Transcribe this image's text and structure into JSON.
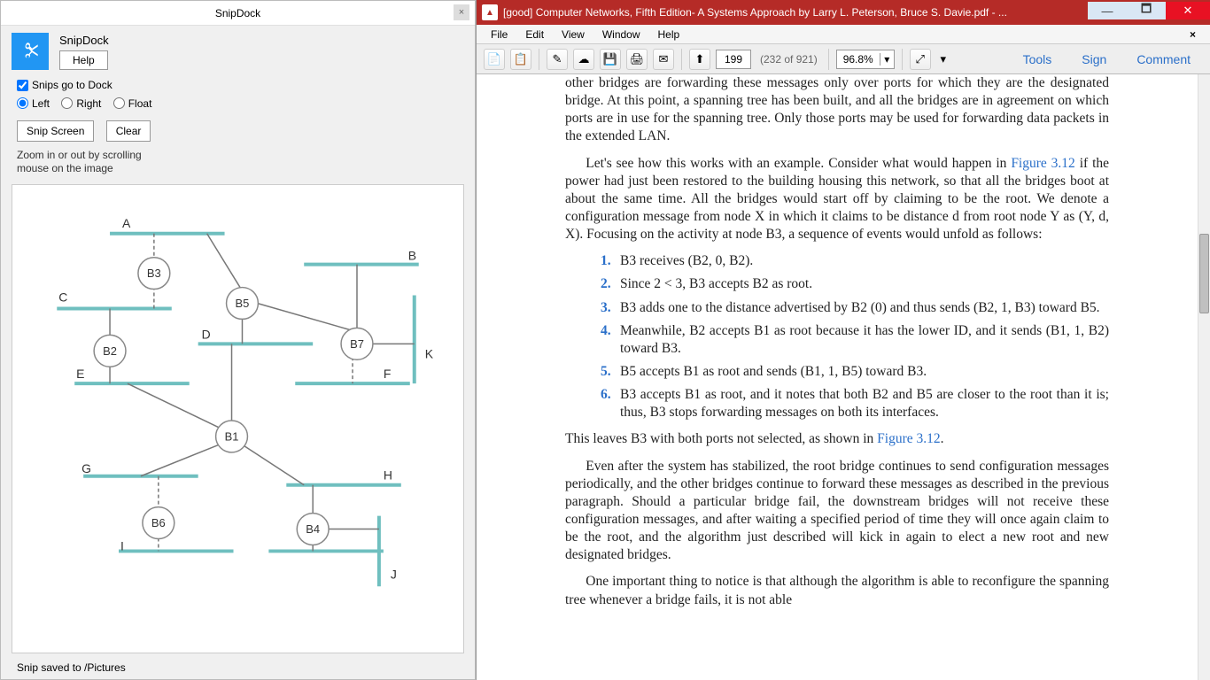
{
  "snipdock": {
    "title": "SnipDock",
    "app_name": "SnipDock",
    "help_btn": "Help",
    "checkbox_label": "Snips go to Dock",
    "checkbox_checked": true,
    "radios": {
      "left": "Left",
      "right": "Right",
      "float": "Float",
      "selected": "left"
    },
    "snip_btn": "Snip Screen",
    "clear_btn": "Clear",
    "hint_line1": "Zoom in or out by scrolling",
    "hint_line2": "mouse on the image",
    "status": "Snip saved to /Pictures"
  },
  "diagram": {
    "labels": {
      "A": "A",
      "B": "B",
      "C": "C",
      "D": "D",
      "E": "E",
      "F": "F",
      "G": "G",
      "H": "H",
      "I": "I",
      "J": "J",
      "K": "K"
    },
    "nodes": {
      "B1": "B1",
      "B2": "B2",
      "B3": "B3",
      "B4": "B4",
      "B5": "B5",
      "B6": "B6",
      "B7": "B7"
    }
  },
  "pdf": {
    "title": "[good] Computer Networks, Fifth Edition- A Systems Approach by Larry L. Peterson, Bruce S. Davie.pdf - ...",
    "menu": {
      "file": "File",
      "edit": "Edit",
      "view": "View",
      "window": "Window",
      "help": "Help"
    },
    "page_current": "199",
    "page_total": "(232 of 921)",
    "zoom": "96.8%",
    "actions": {
      "tools": "Tools",
      "sign": "Sign",
      "comment": "Comment"
    },
    "content": {
      "p1": "other bridges are forwarding these messages only over ports for which they are the designated bridge. At this point, a spanning tree has been built, and all the bridges are in agreement on which ports are in use for the spanning tree. Only those ports may be used for forwarding data packets in the extended LAN.",
      "p2a": "Let's see how this works with an example. Consider what would happen in ",
      "p2link": "Figure 3.12",
      "p2b": " if the power had just been restored to the building housing this network, so that all the bridges boot at about the same time. All the bridges would start off by claiming to be the root. We denote a configuration message from node X in which it claims to be distance d from root node Y as (Y, d, X). Focusing on the activity at node B3, a sequence of events would unfold as follows:",
      "li1": "B3 receives (B2, 0, B2).",
      "li2": "Since 2 < 3, B3 accepts B2 as root.",
      "li3": "B3 adds one to the distance advertised by B2 (0) and thus sends (B2, 1, B3) toward B5.",
      "li4": "Meanwhile, B2 accepts B1 as root because it has the lower ID, and it sends (B1, 1, B2) toward B3.",
      "li5": "B5 accepts B1 as root and sends (B1, 1, B5) toward B3.",
      "li6": "B3 accepts B1 as root, and it notes that both B2 and B5 are closer to the root than it is; thus, B3 stops forwarding messages on both its interfaces.",
      "p3a": "This leaves B3 with both ports not selected, as shown in ",
      "p3link": "Figure 3.12",
      "p3b": ".",
      "p4": "Even after the system has stabilized, the root bridge continues to send configuration messages periodically, and the other bridges continue to forward these messages as described in the previous paragraph. Should a particular bridge fail, the downstream bridges will not receive these configuration messages, and after waiting a specified period of time they will once again claim to be the root, and the algorithm just described will kick in again to elect a new root and new designated bridges.",
      "p5": "One important thing to notice is that although the algorithm is able to reconfigure the spanning tree whenever a bridge fails, it is not able"
    }
  }
}
